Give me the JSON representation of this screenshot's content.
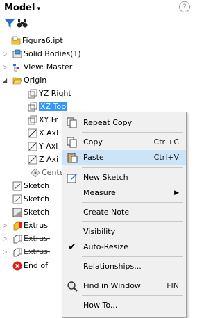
{
  "panel": {
    "title": "Model",
    "title_caret": "▾",
    "corner": "?"
  },
  "toolbar": {
    "filter_icon": "filter-icon",
    "search_icon": "binoculars-icon"
  },
  "tree": {
    "root": "Figura6.ipt",
    "items": [
      {
        "label": "Solid Bodies(1)"
      },
      {
        "label": "View: Master"
      },
      {
        "label": "Origin"
      },
      {
        "label": "YZ Right"
      },
      {
        "label": "XZ Top"
      },
      {
        "label": "XY Fr"
      },
      {
        "label": "X Axi"
      },
      {
        "label": "Y Axi"
      },
      {
        "label": "Z Axi"
      },
      {
        "label": "Cente"
      },
      {
        "label": "Sketch"
      },
      {
        "label": "Sketch"
      },
      {
        "label": "Sketch"
      },
      {
        "label": "Extrusi"
      },
      {
        "label": "Extrusi"
      },
      {
        "label": "Extrusi"
      },
      {
        "label": "End of"
      }
    ]
  },
  "menu": {
    "items": [
      {
        "label": "Repeat Copy",
        "shortcut": ""
      },
      {
        "label": "Copy",
        "shortcut": "Ctrl+C"
      },
      {
        "label": "Paste",
        "shortcut": "Ctrl+V"
      },
      {
        "label": "New Sketch",
        "shortcut": ""
      },
      {
        "label": "Measure",
        "shortcut": ""
      },
      {
        "label": "Create Note",
        "shortcut": ""
      },
      {
        "label": "Visibility",
        "shortcut": ""
      },
      {
        "label": "Auto-Resize",
        "shortcut": ""
      },
      {
        "label": "Relationships...",
        "shortcut": ""
      },
      {
        "label": "Find in Window",
        "shortcut": "FIN"
      },
      {
        "label": "How To...",
        "shortcut": ""
      }
    ],
    "submenu_arrow": "▶",
    "check": "✔"
  }
}
